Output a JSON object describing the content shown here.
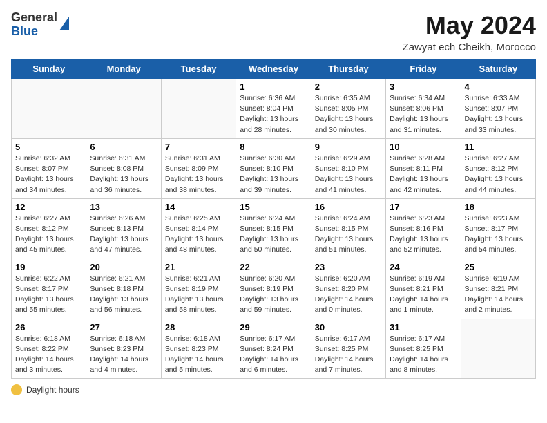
{
  "header": {
    "logo_line1": "General",
    "logo_line2": "Blue",
    "month_title": "May 2024",
    "location": "Zawyat ech Cheikh, Morocco"
  },
  "days_of_week": [
    "Sunday",
    "Monday",
    "Tuesday",
    "Wednesday",
    "Thursday",
    "Friday",
    "Saturday"
  ],
  "weeks": [
    [
      {
        "day": "",
        "info": ""
      },
      {
        "day": "",
        "info": ""
      },
      {
        "day": "",
        "info": ""
      },
      {
        "day": "1",
        "info": "Sunrise: 6:36 AM\nSunset: 8:04 PM\nDaylight: 13 hours\nand 28 minutes."
      },
      {
        "day": "2",
        "info": "Sunrise: 6:35 AM\nSunset: 8:05 PM\nDaylight: 13 hours\nand 30 minutes."
      },
      {
        "day": "3",
        "info": "Sunrise: 6:34 AM\nSunset: 8:06 PM\nDaylight: 13 hours\nand 31 minutes."
      },
      {
        "day": "4",
        "info": "Sunrise: 6:33 AM\nSunset: 8:07 PM\nDaylight: 13 hours\nand 33 minutes."
      }
    ],
    [
      {
        "day": "5",
        "info": "Sunrise: 6:32 AM\nSunset: 8:07 PM\nDaylight: 13 hours\nand 34 minutes."
      },
      {
        "day": "6",
        "info": "Sunrise: 6:31 AM\nSunset: 8:08 PM\nDaylight: 13 hours\nand 36 minutes."
      },
      {
        "day": "7",
        "info": "Sunrise: 6:31 AM\nSunset: 8:09 PM\nDaylight: 13 hours\nand 38 minutes."
      },
      {
        "day": "8",
        "info": "Sunrise: 6:30 AM\nSunset: 8:10 PM\nDaylight: 13 hours\nand 39 minutes."
      },
      {
        "day": "9",
        "info": "Sunrise: 6:29 AM\nSunset: 8:10 PM\nDaylight: 13 hours\nand 41 minutes."
      },
      {
        "day": "10",
        "info": "Sunrise: 6:28 AM\nSunset: 8:11 PM\nDaylight: 13 hours\nand 42 minutes."
      },
      {
        "day": "11",
        "info": "Sunrise: 6:27 AM\nSunset: 8:12 PM\nDaylight: 13 hours\nand 44 minutes."
      }
    ],
    [
      {
        "day": "12",
        "info": "Sunrise: 6:27 AM\nSunset: 8:12 PM\nDaylight: 13 hours\nand 45 minutes."
      },
      {
        "day": "13",
        "info": "Sunrise: 6:26 AM\nSunset: 8:13 PM\nDaylight: 13 hours\nand 47 minutes."
      },
      {
        "day": "14",
        "info": "Sunrise: 6:25 AM\nSunset: 8:14 PM\nDaylight: 13 hours\nand 48 minutes."
      },
      {
        "day": "15",
        "info": "Sunrise: 6:24 AM\nSunset: 8:15 PM\nDaylight: 13 hours\nand 50 minutes."
      },
      {
        "day": "16",
        "info": "Sunrise: 6:24 AM\nSunset: 8:15 PM\nDaylight: 13 hours\nand 51 minutes."
      },
      {
        "day": "17",
        "info": "Sunrise: 6:23 AM\nSunset: 8:16 PM\nDaylight: 13 hours\nand 52 minutes."
      },
      {
        "day": "18",
        "info": "Sunrise: 6:23 AM\nSunset: 8:17 PM\nDaylight: 13 hours\nand 54 minutes."
      }
    ],
    [
      {
        "day": "19",
        "info": "Sunrise: 6:22 AM\nSunset: 8:17 PM\nDaylight: 13 hours\nand 55 minutes."
      },
      {
        "day": "20",
        "info": "Sunrise: 6:21 AM\nSunset: 8:18 PM\nDaylight: 13 hours\nand 56 minutes."
      },
      {
        "day": "21",
        "info": "Sunrise: 6:21 AM\nSunset: 8:19 PM\nDaylight: 13 hours\nand 58 minutes."
      },
      {
        "day": "22",
        "info": "Sunrise: 6:20 AM\nSunset: 8:19 PM\nDaylight: 13 hours\nand 59 minutes."
      },
      {
        "day": "23",
        "info": "Sunrise: 6:20 AM\nSunset: 8:20 PM\nDaylight: 14 hours\nand 0 minutes."
      },
      {
        "day": "24",
        "info": "Sunrise: 6:19 AM\nSunset: 8:21 PM\nDaylight: 14 hours\nand 1 minute."
      },
      {
        "day": "25",
        "info": "Sunrise: 6:19 AM\nSunset: 8:21 PM\nDaylight: 14 hours\nand 2 minutes."
      }
    ],
    [
      {
        "day": "26",
        "info": "Sunrise: 6:18 AM\nSunset: 8:22 PM\nDaylight: 14 hours\nand 3 minutes."
      },
      {
        "day": "27",
        "info": "Sunrise: 6:18 AM\nSunset: 8:23 PM\nDaylight: 14 hours\nand 4 minutes."
      },
      {
        "day": "28",
        "info": "Sunrise: 6:18 AM\nSunset: 8:23 PM\nDaylight: 14 hours\nand 5 minutes."
      },
      {
        "day": "29",
        "info": "Sunrise: 6:17 AM\nSunset: 8:24 PM\nDaylight: 14 hours\nand 6 minutes."
      },
      {
        "day": "30",
        "info": "Sunrise: 6:17 AM\nSunset: 8:25 PM\nDaylight: 14 hours\nand 7 minutes."
      },
      {
        "day": "31",
        "info": "Sunrise: 6:17 AM\nSunset: 8:25 PM\nDaylight: 14 hours\nand 8 minutes."
      },
      {
        "day": "",
        "info": ""
      }
    ]
  ],
  "legend": {
    "icon": "sun-icon",
    "label": "Daylight hours"
  }
}
